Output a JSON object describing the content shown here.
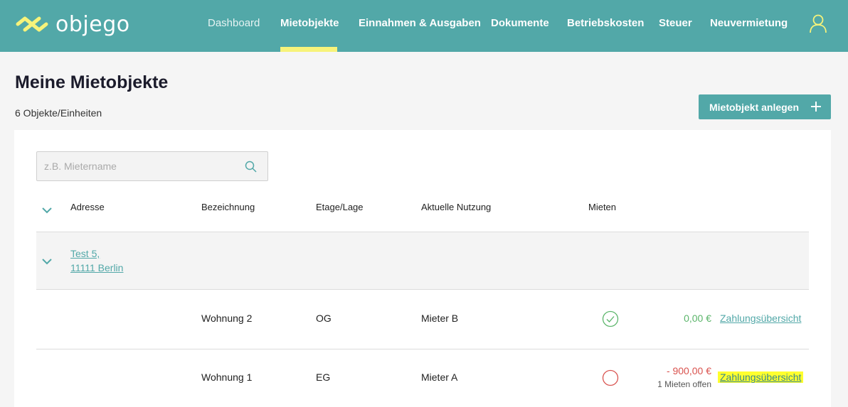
{
  "brand": {
    "name": "objego"
  },
  "nav": {
    "items": [
      {
        "label": "Dashboard",
        "active": false
      },
      {
        "label": "Mietobjekte",
        "active": true
      },
      {
        "label": "Einnahmen & Ausgaben",
        "active": false
      },
      {
        "label": "Dokumente",
        "active": false
      },
      {
        "label": "Betriebskosten",
        "active": false
      },
      {
        "label": "Steuer",
        "active": false
      },
      {
        "label": "Neuvermietung",
        "active": false
      }
    ]
  },
  "page": {
    "title": "Meine Mietobjekte",
    "subtitle": "6 Objekte/Einheiten",
    "add_button": "Mietobjekt anlegen"
  },
  "search": {
    "placeholder": "z.B. Mietername",
    "value": ""
  },
  "table": {
    "headers": {
      "address": "Adresse",
      "name": "Bezeichnung",
      "floor": "Etage/Lage",
      "usage": "Aktuelle Nutzung",
      "rents": "Mieten"
    },
    "group": {
      "address_line1": "Test 5,",
      "address_line2": "11111 Berlin"
    },
    "rows": [
      {
        "name": "Wohnung 2",
        "floor": "OG",
        "usage": "Mieter B",
        "status": "paid",
        "amount": "0,00 €",
        "note": "",
        "link": "Zahlungsübersicht"
      },
      {
        "name": "Wohnung 1",
        "floor": "EG",
        "usage": "Mieter A",
        "status": "open",
        "amount": "- 900,00 €",
        "note": "1 Mieten offen",
        "link": "Zahlungsübersicht"
      }
    ]
  },
  "colors": {
    "brand": "#52a8a8",
    "accent": "#f7f37a",
    "ok": "#5bb56a",
    "bad": "#d9534f"
  },
  "icons": {
    "logo": "objego-logo-icon",
    "user": "user-icon",
    "search": "search-icon",
    "plus": "plus-icon",
    "chevron": "chevron-down-icon",
    "paid": "check-circle-icon",
    "open": "empty-circle-icon"
  }
}
